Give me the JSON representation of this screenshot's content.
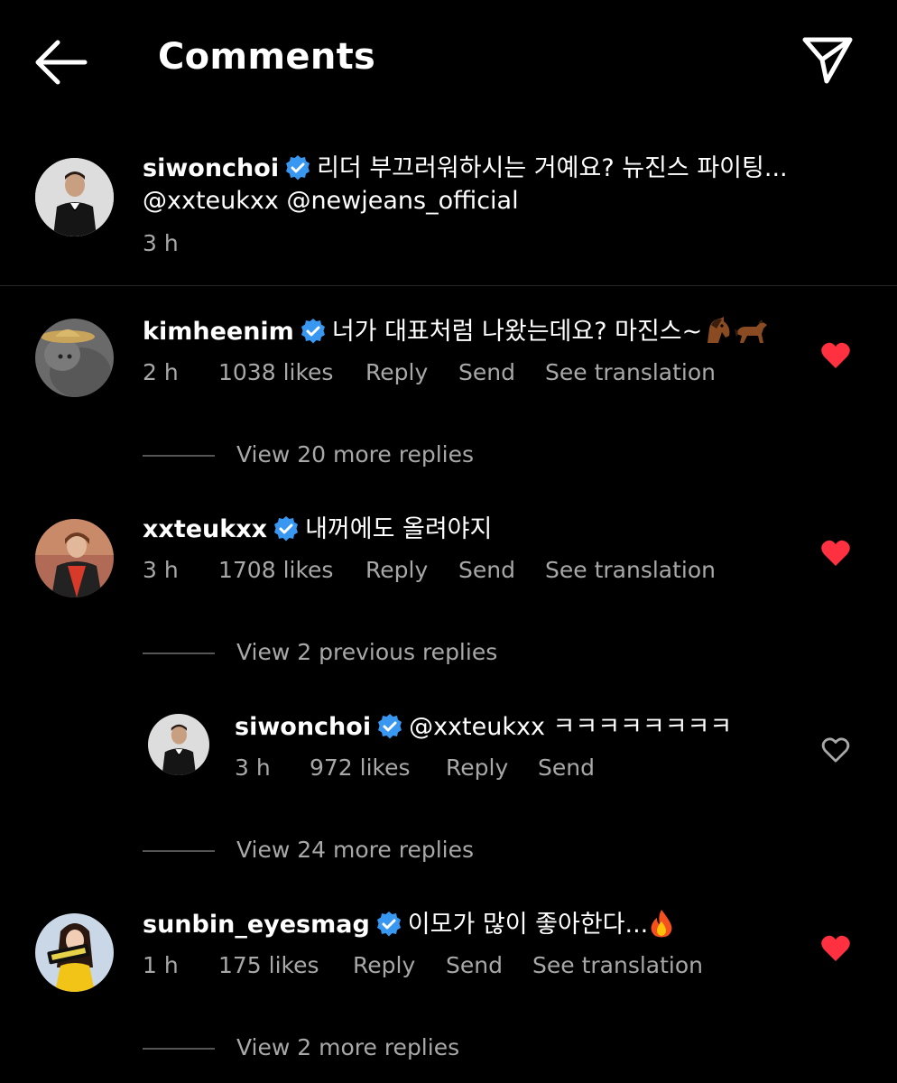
{
  "header": {
    "title": "Comments",
    "back_icon": "arrow-left-icon",
    "share_icon": "paper-plane-icon"
  },
  "caption": {
    "username": "siwonchoi",
    "text": "리더 부끄러워하시는 거예요? 뉴진스 파이팅...",
    "mentions": "@xxteukxx @newjeans_official",
    "time": "3 h"
  },
  "comments": [
    {
      "username": "kimheenim",
      "text": "너가 대표처럼 나왔는데요? 마진스~",
      "emoji": [
        "horse-face-emoji",
        "horse-emoji"
      ],
      "time": "2 h",
      "likes": "1038 likes",
      "reply": "Reply",
      "send": "Send",
      "translate": "See translation",
      "liked": true,
      "more_replies": "View 20 more replies"
    },
    {
      "username": "xxteukxx",
      "text": "내꺼에도 올려야지",
      "time": "3 h",
      "likes": "1708 likes",
      "reply": "Reply",
      "send": "Send",
      "translate": "See translation",
      "liked": true,
      "previous_replies": "View 2 previous replies",
      "reply_item": {
        "username": "siwonchoi",
        "text": "@xxteukxx ㅋㅋㅋㅋㅋㅋㅋㅋ",
        "time": "3 h",
        "likes": "972 likes",
        "reply": "Reply",
        "send": "Send",
        "liked": false
      },
      "more_replies": "View 24 more replies"
    },
    {
      "username": "sunbin_eyesmag",
      "text": "이모가 많이 좋아한다...",
      "emoji": [
        "fire-emoji"
      ],
      "time": "1 h",
      "likes": "175 likes",
      "reply": "Reply",
      "send": "Send",
      "translate": "See translation",
      "liked": true,
      "more_replies": "View 2 more replies"
    }
  ],
  "colors": {
    "background": "#000000",
    "text": "#ffffff",
    "secondary_text": "#a8a8a8",
    "verified_blue": "#3897f0",
    "like_red": "#ff3040"
  }
}
